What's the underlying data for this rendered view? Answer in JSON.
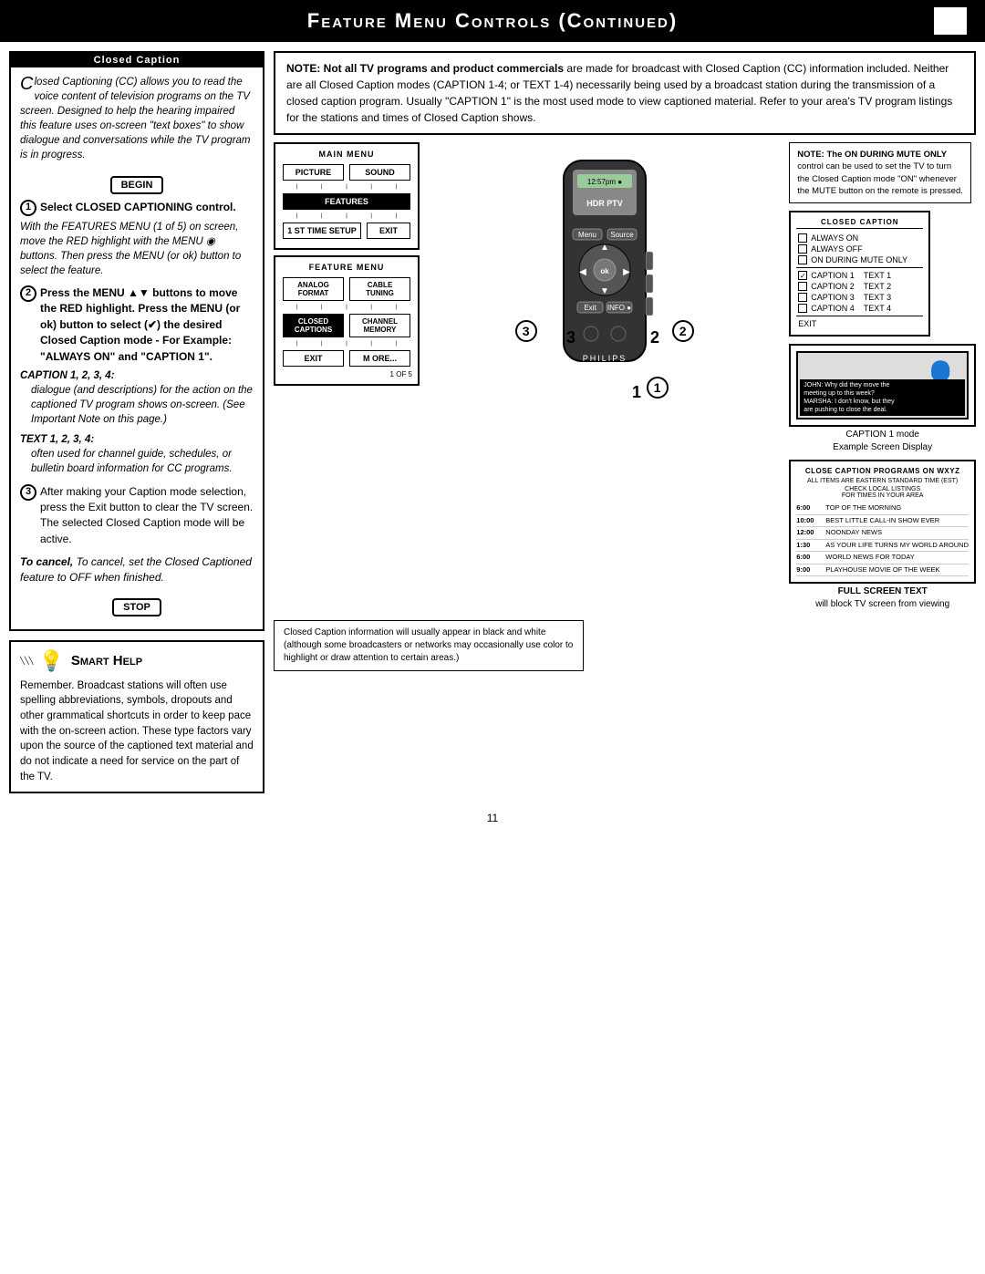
{
  "page": {
    "title": "Feature Menu Controls (Continued)",
    "page_number": "11"
  },
  "cc_section": {
    "header": "Closed Caption",
    "intro": "losed Captioning (CC) allows you to read the voice content of television programs on the TV screen. Designed to help the hearing impaired this feature uses on-screen \"text boxes\" to show dialogue and conversations while the TV program is in progress.",
    "begin_label": "BEGIN",
    "stop_label": "STOP",
    "step1_header": "Select CLOSED CAPTIONING control.",
    "step1_detail": "With the FEATURES MENU (1 of 5) on screen, move the RED highlight  with the MENU ◉ buttons. Then press the MENU (or ok) button to select the feature.",
    "step2_header": "Press the MENU ▲▼ buttons to move the RED highlight. Press the MENU (or ok) button to select (✔) the desired Closed Caption mode - For Example: \"ALWAYS ON\" and \"CAPTION 1\".",
    "caption_header": "CAPTION 1, 2, 3, 4:",
    "caption_detail": "dialogue (and descriptions) for the action on the captioned TV program shows on-screen. (See Important Note on this page.)",
    "text_header": "TEXT 1, 2, 3, 4:",
    "text_detail": "often used for channel guide, schedules, or bulletin board information for CC programs.",
    "step3_detail": "After making your Caption mode selection, press the Exit button to clear the TV screen. The selected Closed Caption mode will be active.",
    "cancel_text": "To cancel, set the Closed Captioned feature to OFF when finished."
  },
  "smart_help": {
    "header": "Smart Help",
    "text": "Remember. Broadcast stations will often use spelling abbreviations, symbols, dropouts and other grammatical shortcuts in order to keep pace with the on-screen action. These type factors vary upon the source of the captioned text material and do not indicate a need for service on the part of the TV."
  },
  "note_box": {
    "text_bold": "NOTE: Not all TV programs and product commercials",
    "text": " are made for broadcast with Closed Caption (CC) information included. Neither are all Closed Caption modes (CAPTION 1-4; or TEXT 1-4) necessarily being used by a broadcast station during the transmission of a closed caption program. Usually \"CAPTION 1\" is the most used mode to view captioned material. Refer to your area's TV program listings for the stations and times of Closed Caption shows."
  },
  "main_menu": {
    "label": "MAIN MENU",
    "buttons": [
      "PICTURE",
      "SOUND",
      "FEATURES",
      "1 ST TIME SETUP",
      "EXIT"
    ]
  },
  "feature_menu": {
    "label": "FEATURE MENU",
    "items": [
      "ANALOG FORMAT",
      "CABLE TUNING",
      "CLOSED CAPTIONS",
      "CHANNEL MEMORY",
      "MORE...",
      "EXIT"
    ],
    "of_label": "1 OF 5"
  },
  "cc_menu": {
    "label": "CLOSED CAPTION",
    "items": [
      {
        "label": "ALWAYS ON",
        "checked": false
      },
      {
        "label": "ALWAYS OFF",
        "checked": false
      },
      {
        "label": "ON DURING MUTE ONLY",
        "checked": false
      }
    ],
    "captions": [
      {
        "label": "CAPTION 1",
        "checked": true
      },
      {
        "label": "CAPTION 2",
        "checked": false
      },
      {
        "label": "CAPTION 3",
        "checked": false
      },
      {
        "label": "CAPTION 4",
        "checked": false
      }
    ],
    "texts": [
      {
        "label": "TEXT 1"
      },
      {
        "label": "TEXT 2"
      },
      {
        "label": "TEXT 3"
      },
      {
        "label": "TEXT 4"
      }
    ],
    "exit": "EXIT"
  },
  "on_screen_note": {
    "bold": "NOTE: The ON DURING MUTE ONLY",
    "text": " control can be used to set the TV to turn the Closed Caption mode \"ON\" whenever the MUTE button on the remote is pressed."
  },
  "caption_display": {
    "title": "CAPTION 1 mode",
    "subtitle": "Example Screen Display",
    "dialogue": [
      "JOHN: Why did they move the",
      "meeting up to this week?",
      "MARSHA: I don't know, but they",
      "are pushing to close the deal."
    ]
  },
  "fullscreen_text": {
    "header1": "CLOSE CAPTION PROGRAMS ON WXYZ",
    "header2": "ALL ITEMS ARE EASTERN STANDARD TIME (EST)",
    "header3": "CHECK LOCAL LISTINGS",
    "header4": "FOR TIMES IN YOUR AREA",
    "programs": [
      {
        "time": "6:00",
        "show": "TOP OF THE MORNING"
      },
      {
        "time": "10:00",
        "show": "BEST LITTLE CALL-IN SHOW EVER"
      },
      {
        "time": "12:00",
        "show": "NOONDAY NEWS"
      },
      {
        "time": "1:30",
        "show": "AS YOUR LIFE TURNS MY WORLD AROUND"
      },
      {
        "time": "6:00",
        "show": "WORLD NEWS FOR TODAY"
      },
      {
        "time": "9:00",
        "show": "PLAYHOUSE MOVIE OF THE WEEK"
      }
    ],
    "caption": "FULL SCREEN TEXT",
    "caption2": "will block TV screen from viewing"
  },
  "remote_note": "Closed Caption information will usually appear in black and white (although some broadcasters or networks may occasionally use color to highlight or draw attention to certain areas.)"
}
